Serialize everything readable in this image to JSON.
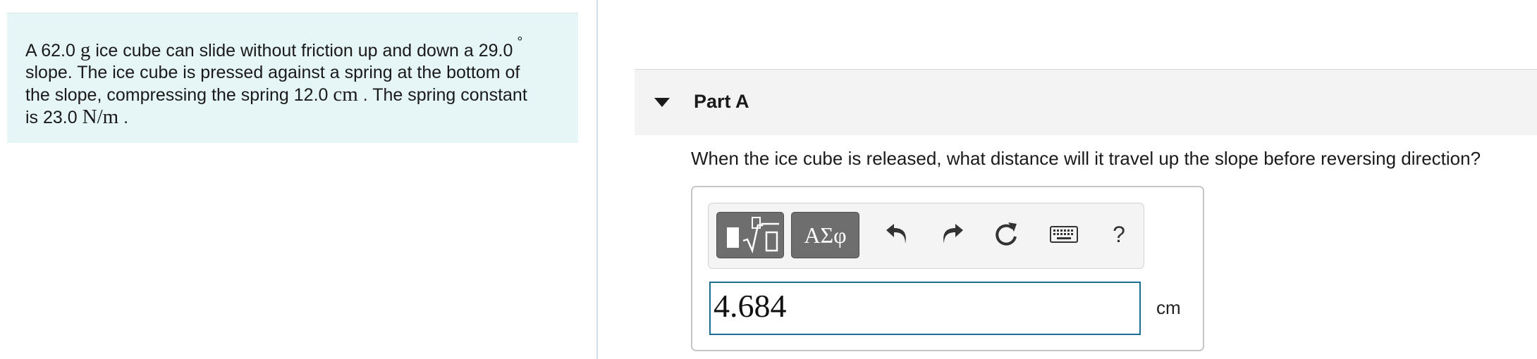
{
  "problem": {
    "seg1": "A 62.0",
    "mass_unit": "g",
    "seg2": "ice cube can slide without friction up and down a 29.0",
    "degree_symbol": "°",
    "seg3": "slope. The ice cube is pressed against a spring at the bottom of",
    "seg4": "the slope, compressing the spring 12.0",
    "length_unit": "cm",
    "seg5": ". The spring constant",
    "seg6": "is 23.0",
    "spring_unit": "N/m",
    "seg7": "."
  },
  "part": {
    "title": "Part A"
  },
  "question": "When the ice cube is released, what distance will it travel up the slope before reversing direction?",
  "toolbar": {
    "symbols_label": "ΑΣφ",
    "help_label": "?",
    "icons": [
      "templates-icon",
      "undo-icon",
      "redo-icon",
      "reset-icon",
      "keyboard-icon",
      "help-icon"
    ]
  },
  "answer": {
    "value": "4.684",
    "unit": "cm"
  },
  "colors": {
    "problem_bg": "#e6f5f5",
    "input_border": "#1c6c94",
    "header_bg": "#f3f3f3"
  }
}
